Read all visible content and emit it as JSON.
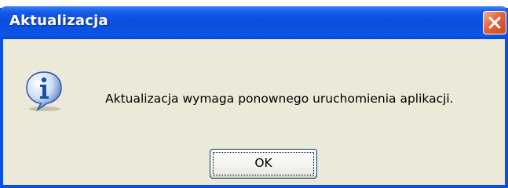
{
  "window": {
    "title": "Aktualizacja",
    "close_icon": "close-icon",
    "accent_color": "#0a4fe0",
    "close_color": "#e3643a"
  },
  "dialog": {
    "icon": "info-icon",
    "message": "Aktualizacja wymaga ponownego uruchomienia aplikacji.",
    "ok_label": "OK"
  }
}
